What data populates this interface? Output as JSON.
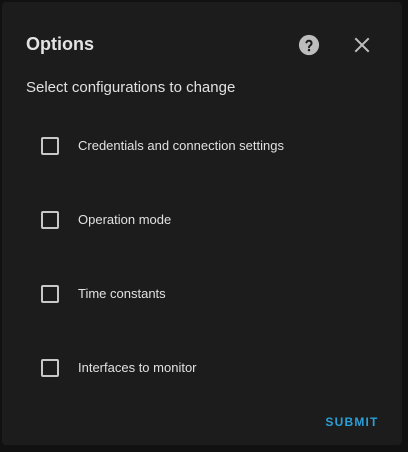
{
  "dialog": {
    "title": "Options",
    "subtitle": "Select configurations to change",
    "help_icon": "help-circle-icon",
    "close_icon": "close-icon",
    "options": [
      {
        "label": "Credentials and connection settings",
        "checked": false
      },
      {
        "label": "Operation mode",
        "checked": false
      },
      {
        "label": "Time constants",
        "checked": false
      },
      {
        "label": "Interfaces to monitor",
        "checked": false
      }
    ],
    "submit_label": "SUBMIT"
  },
  "colors": {
    "background": "#111111",
    "surface": "#1c1c1c",
    "text": "#e1e1e1",
    "accent": "#2a9fd8",
    "icon": "#bdbdbd"
  }
}
